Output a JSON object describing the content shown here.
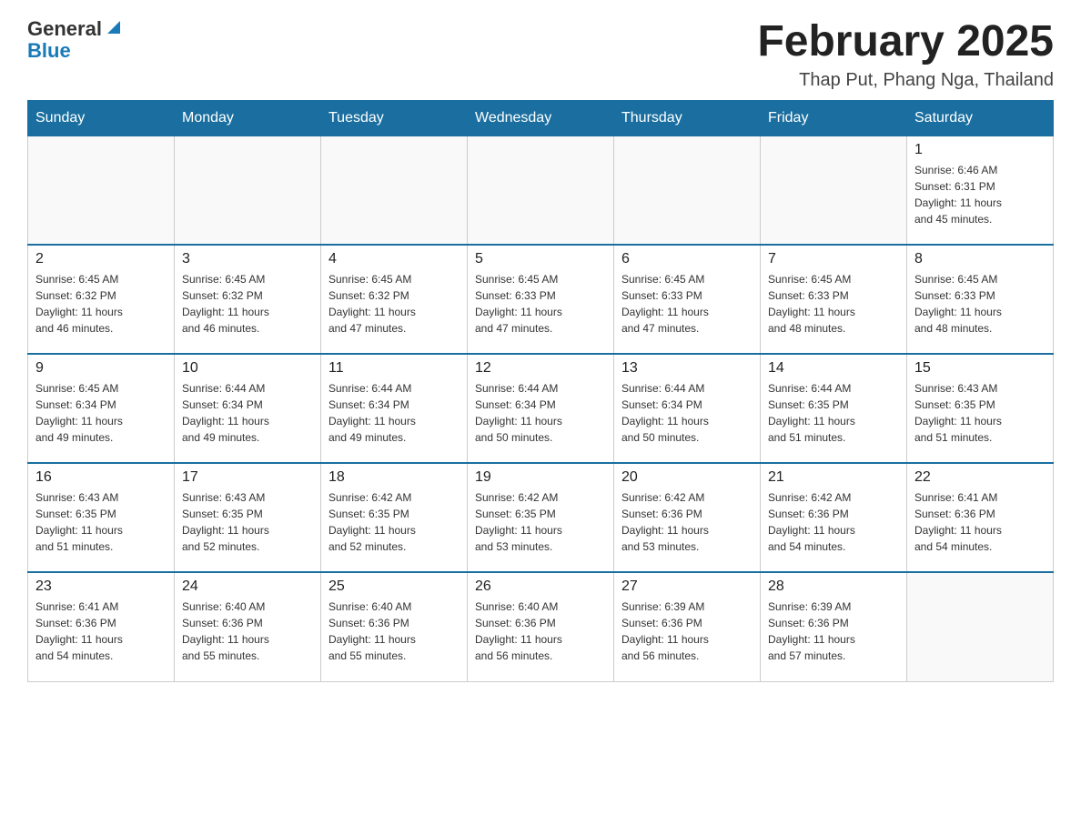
{
  "header": {
    "logo_general": "General",
    "logo_blue": "Blue",
    "month_title": "February 2025",
    "location": "Thap Put, Phang Nga, Thailand"
  },
  "days_of_week": [
    "Sunday",
    "Monday",
    "Tuesday",
    "Wednesday",
    "Thursday",
    "Friday",
    "Saturday"
  ],
  "weeks": [
    [
      {
        "day": "",
        "info": ""
      },
      {
        "day": "",
        "info": ""
      },
      {
        "day": "",
        "info": ""
      },
      {
        "day": "",
        "info": ""
      },
      {
        "day": "",
        "info": ""
      },
      {
        "day": "",
        "info": ""
      },
      {
        "day": "1",
        "info": "Sunrise: 6:46 AM\nSunset: 6:31 PM\nDaylight: 11 hours\nand 45 minutes."
      }
    ],
    [
      {
        "day": "2",
        "info": "Sunrise: 6:45 AM\nSunset: 6:32 PM\nDaylight: 11 hours\nand 46 minutes."
      },
      {
        "day": "3",
        "info": "Sunrise: 6:45 AM\nSunset: 6:32 PM\nDaylight: 11 hours\nand 46 minutes."
      },
      {
        "day": "4",
        "info": "Sunrise: 6:45 AM\nSunset: 6:32 PM\nDaylight: 11 hours\nand 47 minutes."
      },
      {
        "day": "5",
        "info": "Sunrise: 6:45 AM\nSunset: 6:33 PM\nDaylight: 11 hours\nand 47 minutes."
      },
      {
        "day": "6",
        "info": "Sunrise: 6:45 AM\nSunset: 6:33 PM\nDaylight: 11 hours\nand 47 minutes."
      },
      {
        "day": "7",
        "info": "Sunrise: 6:45 AM\nSunset: 6:33 PM\nDaylight: 11 hours\nand 48 minutes."
      },
      {
        "day": "8",
        "info": "Sunrise: 6:45 AM\nSunset: 6:33 PM\nDaylight: 11 hours\nand 48 minutes."
      }
    ],
    [
      {
        "day": "9",
        "info": "Sunrise: 6:45 AM\nSunset: 6:34 PM\nDaylight: 11 hours\nand 49 minutes."
      },
      {
        "day": "10",
        "info": "Sunrise: 6:44 AM\nSunset: 6:34 PM\nDaylight: 11 hours\nand 49 minutes."
      },
      {
        "day": "11",
        "info": "Sunrise: 6:44 AM\nSunset: 6:34 PM\nDaylight: 11 hours\nand 49 minutes."
      },
      {
        "day": "12",
        "info": "Sunrise: 6:44 AM\nSunset: 6:34 PM\nDaylight: 11 hours\nand 50 minutes."
      },
      {
        "day": "13",
        "info": "Sunrise: 6:44 AM\nSunset: 6:34 PM\nDaylight: 11 hours\nand 50 minutes."
      },
      {
        "day": "14",
        "info": "Sunrise: 6:44 AM\nSunset: 6:35 PM\nDaylight: 11 hours\nand 51 minutes."
      },
      {
        "day": "15",
        "info": "Sunrise: 6:43 AM\nSunset: 6:35 PM\nDaylight: 11 hours\nand 51 minutes."
      }
    ],
    [
      {
        "day": "16",
        "info": "Sunrise: 6:43 AM\nSunset: 6:35 PM\nDaylight: 11 hours\nand 51 minutes."
      },
      {
        "day": "17",
        "info": "Sunrise: 6:43 AM\nSunset: 6:35 PM\nDaylight: 11 hours\nand 52 minutes."
      },
      {
        "day": "18",
        "info": "Sunrise: 6:42 AM\nSunset: 6:35 PM\nDaylight: 11 hours\nand 52 minutes."
      },
      {
        "day": "19",
        "info": "Sunrise: 6:42 AM\nSunset: 6:35 PM\nDaylight: 11 hours\nand 53 minutes."
      },
      {
        "day": "20",
        "info": "Sunrise: 6:42 AM\nSunset: 6:36 PM\nDaylight: 11 hours\nand 53 minutes."
      },
      {
        "day": "21",
        "info": "Sunrise: 6:42 AM\nSunset: 6:36 PM\nDaylight: 11 hours\nand 54 minutes."
      },
      {
        "day": "22",
        "info": "Sunrise: 6:41 AM\nSunset: 6:36 PM\nDaylight: 11 hours\nand 54 minutes."
      }
    ],
    [
      {
        "day": "23",
        "info": "Sunrise: 6:41 AM\nSunset: 6:36 PM\nDaylight: 11 hours\nand 54 minutes."
      },
      {
        "day": "24",
        "info": "Sunrise: 6:40 AM\nSunset: 6:36 PM\nDaylight: 11 hours\nand 55 minutes."
      },
      {
        "day": "25",
        "info": "Sunrise: 6:40 AM\nSunset: 6:36 PM\nDaylight: 11 hours\nand 55 minutes."
      },
      {
        "day": "26",
        "info": "Sunrise: 6:40 AM\nSunset: 6:36 PM\nDaylight: 11 hours\nand 56 minutes."
      },
      {
        "day": "27",
        "info": "Sunrise: 6:39 AM\nSunset: 6:36 PM\nDaylight: 11 hours\nand 56 minutes."
      },
      {
        "day": "28",
        "info": "Sunrise: 6:39 AM\nSunset: 6:36 PM\nDaylight: 11 hours\nand 57 minutes."
      },
      {
        "day": "",
        "info": ""
      }
    ]
  ]
}
